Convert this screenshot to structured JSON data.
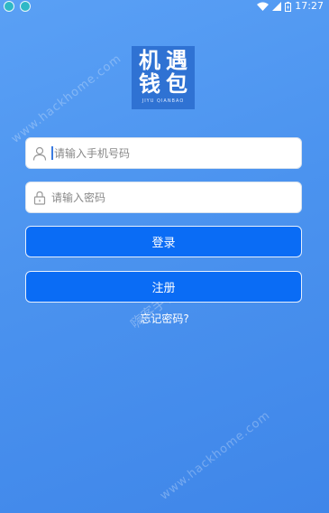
{
  "status_bar": {
    "time": "17:27"
  },
  "logo": {
    "chars": [
      "机",
      "遇",
      "钱",
      "包"
    ],
    "subtitle": "JIYU QIANBAO"
  },
  "form": {
    "phone_placeholder": "请输入手机号码",
    "password_placeholder": "请输入密码"
  },
  "actions": {
    "login_label": "登录",
    "register_label": "注册",
    "forgot_label": "忘记密码?"
  },
  "watermark": {
    "site": "www.hackhome.com",
    "site_cn": "嗨客手机站"
  },
  "colors": {
    "background": "#4b93ef",
    "button": "#0a6cf5",
    "logo_bg": "#2f72d3"
  }
}
